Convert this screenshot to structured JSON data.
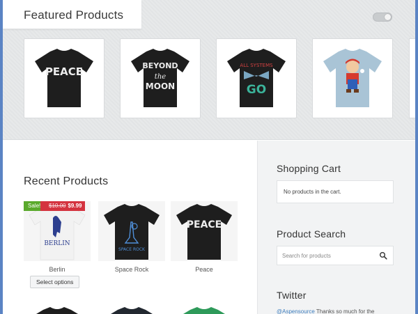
{
  "featured": {
    "title": "Featured Products",
    "products": [
      {
        "name": "Peace",
        "print": "PEACE",
        "shirt_color": "#1e1e1e"
      },
      {
        "name": "Beyond the Moon",
        "print": "BEYOND the MOON",
        "shirt_color": "#1e1e1e"
      },
      {
        "name": "All Systems Go",
        "print": "ALL SYSTEMS GO",
        "shirt_color": "#1e1e1e"
      },
      {
        "name": "Mario",
        "print": "",
        "shirt_color": "#a9c4d6"
      }
    ]
  },
  "recent": {
    "title": "Recent Products",
    "products": [
      {
        "name": "Berlin",
        "sale_label": "Sale!",
        "old_price": "$10.00",
        "new_price": "$9.99",
        "button": "Select options",
        "print": "BERLIN"
      },
      {
        "name": "Space Rock",
        "print": "SPACE ROCK"
      },
      {
        "name": "Peace",
        "print": "PEACE"
      }
    ]
  },
  "sidebar": {
    "cart_title": "Shopping Cart",
    "cart_empty": "No products in the cart.",
    "search_title": "Product Search",
    "search_placeholder": "Search for products",
    "twitter_title": "Twitter",
    "tweet_handle": "@Aspensource",
    "tweet_text": " Thanks so much for the"
  },
  "colors": {
    "sale_green": "#5aa92c",
    "price_red": "#d4333f",
    "link_blue": "#3f7fbf",
    "frame_blue": "#5b84c4"
  }
}
